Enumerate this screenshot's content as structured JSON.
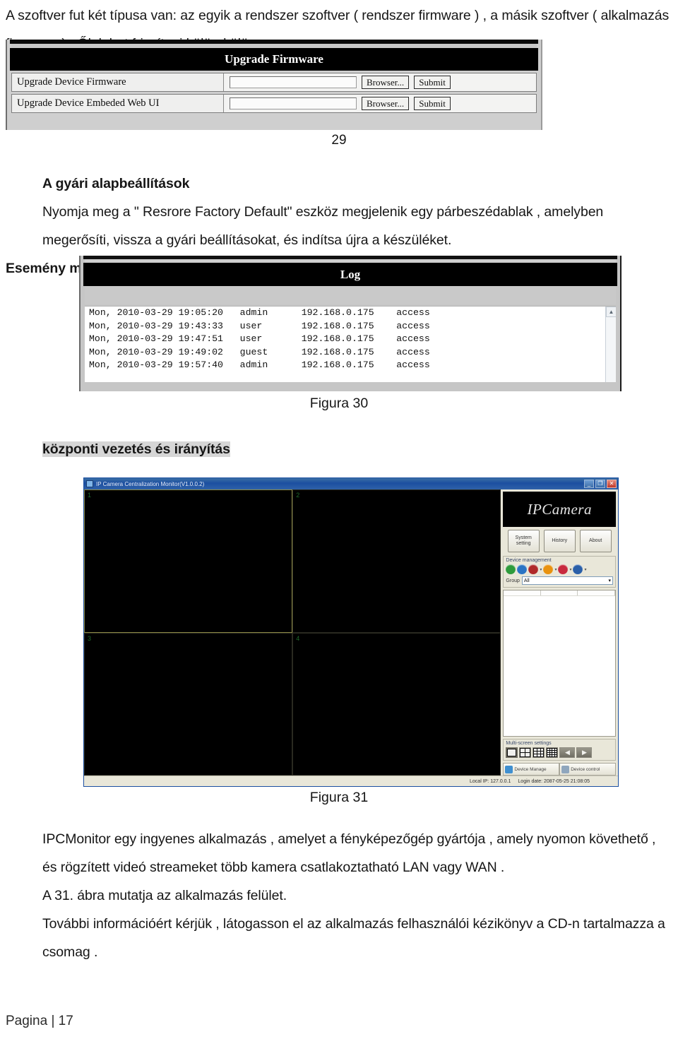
{
  "document": {
    "intro_paragraph": "A szoftver fut két típusa van: az egyik a rendszer szoftver ( rendszer firmware ) , a másik szoftver ( alkalmazás firmware ) . Ők lehet frissíteni külön-külön.",
    "page_marker": "29",
    "factory_heading": "A gyári alapbeállítások",
    "factory_body": "Nyomja meg a \" Resrore Factory Default\" eszköz megjelenik egy párbeszédablak , amelyben megerősíti, vissza a gyári beállításokat, és indítsa újra a készüléket.",
    "event_memory_heading": "Esemény memória",
    "figure_30_caption": "Figura 30",
    "central_management_heading": "központi vezetés és irányítás",
    "figure_31_caption": "Figura 31",
    "closing_paragraph_1": "IPCMonitor egy ingyenes alkalmazás , amelyet a fényképezőgép gyártója , amely nyomon követhető , és rögzített videó streameket több kamera csatlakoztatható LAN vagy WAN .",
    "closing_paragraph_2": "A 31. ábra mutatja az alkalmazás felület.",
    "closing_paragraph_3": "További információért kérjük , látogasson el az alkalmazás felhasználói kézikönyv a CD-n tartalmazza a csomag .",
    "footer": "Pagina | 17"
  },
  "firmware_panel": {
    "title": "Upgrade Firmware",
    "rows": [
      {
        "label": "Upgrade Device Firmware",
        "value": "",
        "browse_label": "Browser...",
        "submit_label": "Submit"
      },
      {
        "label": "Upgrade Device Embeded Web UI",
        "value": "",
        "browse_label": "Browser...",
        "submit_label": "Submit"
      }
    ]
  },
  "log_panel": {
    "title": "Log",
    "entries": [
      "Mon, 2010-03-29 19:05:20   admin      192.168.0.175    access",
      "Mon, 2010-03-29 19:43:33   user       192.168.0.175    access",
      "Mon, 2010-03-29 19:47:51   user       192.168.0.175    access",
      "Mon, 2010-03-29 19:49:02   guest      192.168.0.175    access",
      "Mon, 2010-03-29 19:57:40   admin      192.168.0.175    access"
    ]
  },
  "ipcamera_app": {
    "window_title": "IP Camera Centralization Monitor(V1.0.0.2)",
    "minimize_glyph": "_",
    "restore_glyph": "❐",
    "close_glyph": "✕",
    "logo_text": "IPCamera",
    "buttons": [
      {
        "label": "System setting"
      },
      {
        "label": "History"
      },
      {
        "label": "About"
      }
    ],
    "device_management": {
      "title": "Device management",
      "icons": [
        {
          "name": "add-device-icon",
          "color": "#2e9b3c"
        },
        {
          "name": "search-device-icon",
          "color": "#2a74c4"
        },
        {
          "name": "edit-device-icon",
          "color": "#b02a2a"
        },
        {
          "name": "delete-device-icon",
          "color": "#e8920f"
        },
        {
          "name": "play-device-icon",
          "color": "#c82a3e"
        },
        {
          "name": "stop-device-icon",
          "color": "#2a5fa8"
        }
      ],
      "group_label": "Group",
      "group_value": "All"
    },
    "multi_screen": {
      "title": "Multi-screen settings",
      "layouts": [
        "1",
        "4",
        "9",
        "16"
      ],
      "selected_layout": "1",
      "prev_glyph": "◀",
      "next_glyph": "▶"
    },
    "bottom_tabs": [
      {
        "label": "Device Manage"
      },
      {
        "label": "Device control"
      }
    ],
    "video_panes": [
      "1",
      "2",
      "3",
      "4"
    ],
    "active_pane": "1",
    "status": {
      "local_ip": "Local IP: 127.0.0.1",
      "login_date": "Login date: 2087-05-25 21:08:05"
    }
  }
}
